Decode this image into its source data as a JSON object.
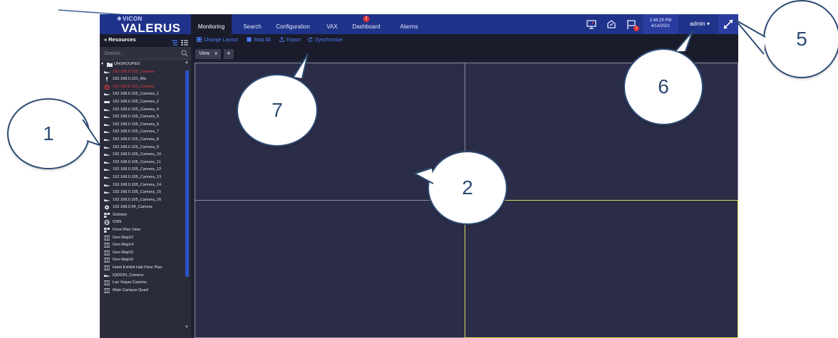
{
  "app": {
    "brand_sub": "VICON",
    "brand_main": "VALERUS",
    "nav_tabs": [
      {
        "label": "Monitoring",
        "active": true
      },
      {
        "label": "Search"
      },
      {
        "label": "Configuration"
      },
      {
        "label": "VAX"
      },
      {
        "label": "Dashboard",
        "alert": true
      },
      {
        "label": "Alarms"
      }
    ],
    "dashboard_alert_glyph": "!",
    "notification_count": "1",
    "clock": {
      "time": "2:46:29 PM",
      "date": "4/14/2021"
    },
    "user": "admin",
    "user_caret": "▾"
  },
  "toolbar": {
    "resources_title": "Resources",
    "collapse_glyph": "«",
    "actions": {
      "change_layout": "Change Layout",
      "stop_all": "Stop All",
      "export": "Export",
      "synchronize": "Synchronize"
    }
  },
  "search": {
    "placeholder": "Search..."
  },
  "tree": {
    "group_caret": "▾",
    "items": [
      {
        "label": "UNGROUPED",
        "icon": "folder-icon",
        "group": true
      },
      {
        "label": "192.168.0.100_Camera",
        "icon": "camera-icon",
        "error": true
      },
      {
        "label": "192.168.0.101_Mic",
        "icon": "microphone-icon"
      },
      {
        "label": "192.168.0.103_Camera",
        "icon": "camera-error-icon",
        "error": true
      },
      {
        "label": "192.168.0.105_Camera_1",
        "icon": "camera-icon"
      },
      {
        "label": "192.168.0.105_Camera_2",
        "icon": "box-camera-icon"
      },
      {
        "label": "192.168.0.105_Camera_4",
        "icon": "camera-icon"
      },
      {
        "label": "192.168.0.105_Camera_5",
        "icon": "camera-icon"
      },
      {
        "label": "192.168.0.105_Camera_6",
        "icon": "camera-icon"
      },
      {
        "label": "192.168.0.105_Camera_7",
        "icon": "camera-icon"
      },
      {
        "label": "192.168.0.105_Camera_8",
        "icon": "camera-icon"
      },
      {
        "label": "192.168.0.105_Camera_9",
        "icon": "camera-icon"
      },
      {
        "label": "192.168.0.105_Camera_10",
        "icon": "camera-icon"
      },
      {
        "label": "192.168.0.105_Camera_11",
        "icon": "camera-icon"
      },
      {
        "label": "192.168.0.105_Camera_12",
        "icon": "camera-icon"
      },
      {
        "label": "192.168.0.105_Camera_13",
        "icon": "camera-icon"
      },
      {
        "label": "192.168.0.105_Camera_14",
        "icon": "camera-icon"
      },
      {
        "label": "192.168.0.105_Camera_15",
        "icon": "camera-icon"
      },
      {
        "label": "192.168.0.105_Camera_16",
        "icon": "camera-icon"
      },
      {
        "label": "192.168.0.54_Camera",
        "icon": "dome-camera-icon"
      },
      {
        "label": "3x3view",
        "icon": "view-icon"
      },
      {
        "label": "CNN",
        "icon": "globe-icon"
      },
      {
        "label": "Floor Plan View",
        "icon": "view-icon"
      },
      {
        "label": "Geo Map12",
        "icon": "map-icon"
      },
      {
        "label": "Geo Map14",
        "icon": "map-icon"
      },
      {
        "label": "Geo Map15",
        "icon": "map-icon"
      },
      {
        "label": "Geo Map16",
        "icon": "map-icon"
      },
      {
        "label": "Hotel Exhibit Hall Floor Plan",
        "icon": "map-icon"
      },
      {
        "label": "IQD62N_Camera",
        "icon": "camera-icon"
      },
      {
        "label": "Las Vegas Casinos",
        "icon": "map-icon"
      },
      {
        "label": "Main Campus Quad",
        "icon": "map-icon"
      }
    ]
  },
  "view_tab": {
    "label": "View",
    "close_glyph": "x",
    "add_glyph": "+"
  },
  "callouts": [
    "1",
    "2",
    "5",
    "6",
    "7"
  ],
  "colors": {
    "topbar": "#20338a",
    "panel": "#2a2c3a",
    "grid": "#2b2d48",
    "link": "#4d7dff",
    "error": "#e23b3b",
    "selected_cell": "#d8dc5a",
    "callout_border": "#2d4a73"
  }
}
